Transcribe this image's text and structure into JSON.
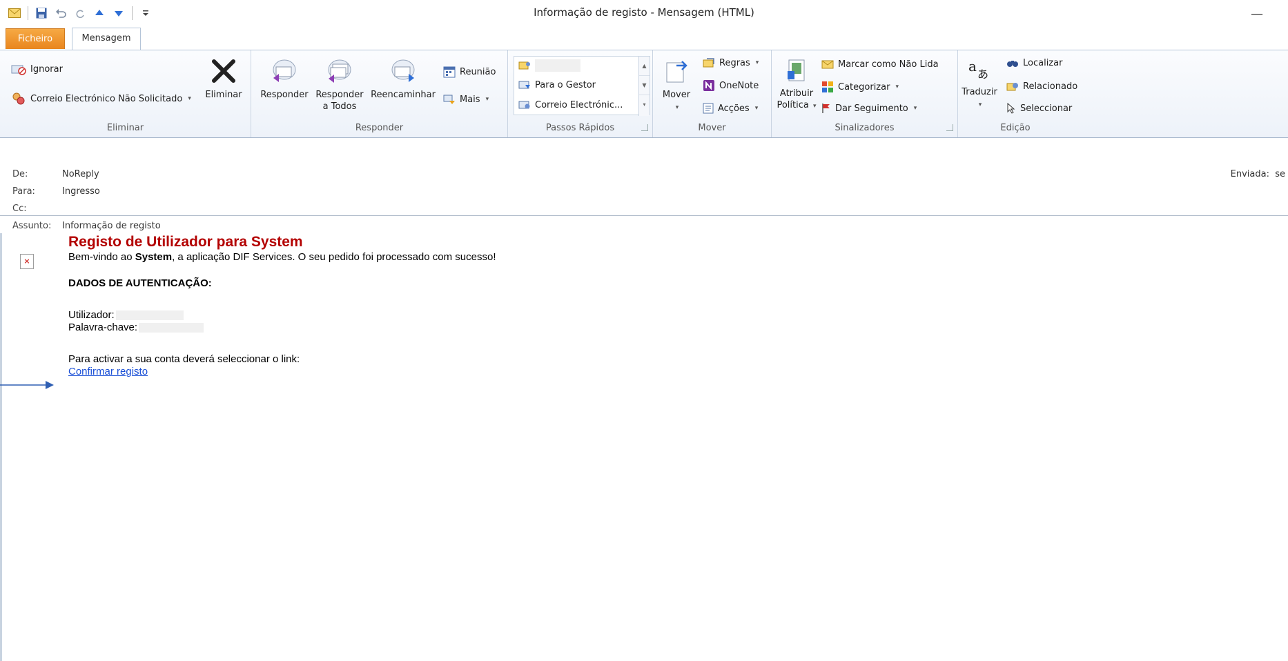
{
  "window": {
    "title": "Informação de registo  -  Mensagem (HTML)",
    "minimize_glyph": "—"
  },
  "tabs": [
    {
      "label": "Ficheiro"
    },
    {
      "label": "Mensagem"
    }
  ],
  "ribbon": {
    "eliminar": {
      "label": "Eliminar",
      "ignorar": "Ignorar",
      "junk": "Correio Electrónico Não Solicitado",
      "delete": "Eliminar"
    },
    "responder": {
      "label": "Responder",
      "reply": "Responder",
      "reply_all_1": "Responder",
      "reply_all_2": "a Todos",
      "forward": "Reencaminhar",
      "meeting": "Reunião",
      "more": "Mais"
    },
    "passos": {
      "label": "Passos Rápidos",
      "item2": "Para o Gestor",
      "item3": "Correio Electrónic..."
    },
    "mover": {
      "label": "Mover",
      "move": "Mover",
      "rules": "Regras",
      "onenote": "OneNote",
      "actions": "Acções"
    },
    "sinalizadores": {
      "label": "Sinalizadores",
      "policy_1": "Atribuir",
      "policy_2": "Política",
      "unread": "Marcar como Não Lida",
      "categorize": "Categorizar",
      "followup": "Dar Seguimento"
    },
    "edicao": {
      "label": "Edição",
      "translate": "Traduzir",
      "find": "Localizar",
      "related": "Relacionado",
      "select": "Seleccionar"
    }
  },
  "header": {
    "from_label": "De:",
    "from": "NoReply",
    "to_label": "Para:",
    "to": "Ingresso",
    "cc_label": "Cc:",
    "subject_label": "Assunto:",
    "subject": "Informação de registo",
    "sent_label": "Enviada:",
    "sent_value": "se"
  },
  "email": {
    "title": "Registo de Utilizador para System",
    "welcome_pre": "Bem-vindo ao ",
    "welcome_bold": "System",
    "welcome_post": ", a aplicação DIF Services. O seu pedido foi processado com sucesso!",
    "auth_heading": "DADOS DE AUTENTICAÇÃO:",
    "user_label": "Utilizador:",
    "password_label": "Palavra-chave:",
    "activate_text": "Para activar a sua conta deverá seleccionar o link:",
    "link_text": "Confirmar registo",
    "broken_image_glyph": "×"
  },
  "colors": {
    "file_tab": "#e9861e",
    "title_red": "#b30000",
    "link_blue": "#1a4fd6",
    "annotation_arrow": "#2f5fb3"
  }
}
